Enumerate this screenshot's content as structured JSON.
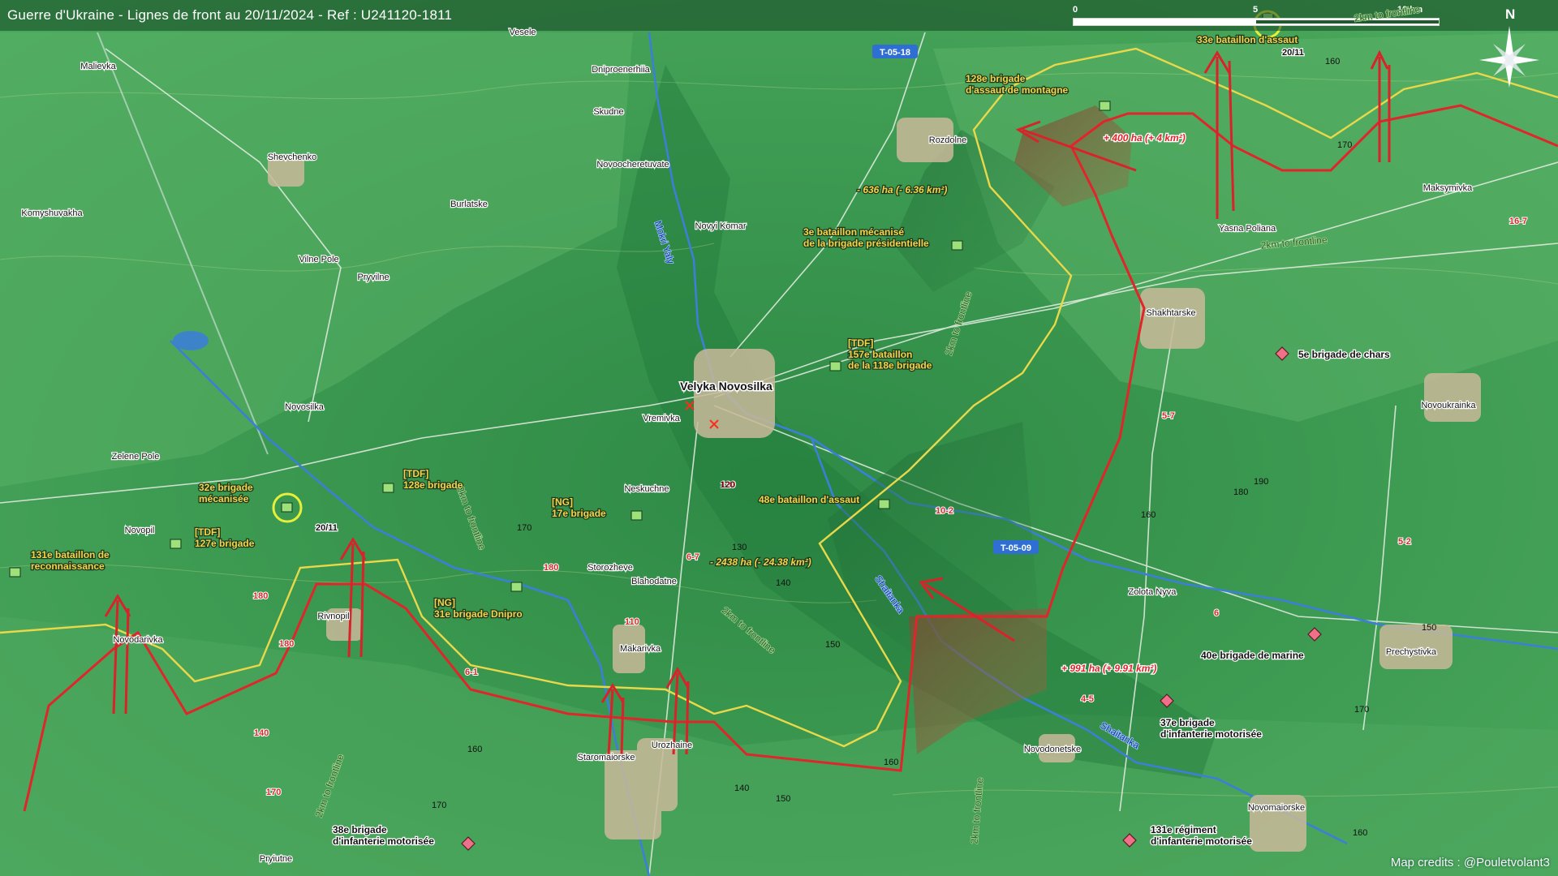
{
  "title": "Guerre d'Ukraine - Lignes de front au 20/11/2024 - Ref : U241120-1811",
  "credits": "Map credits : @Pouletvolant3",
  "scale": {
    "zero": "0",
    "mid": "5",
    "end": "10 km"
  },
  "compass": "N",
  "colors": {
    "background": "#3f9a55",
    "ukraine_line": "#e9d84a",
    "russia_line": "#e0252b",
    "river": "#3c7fd6",
    "gain_area": "#8a5a3a",
    "label": "#f7d34a"
  },
  "places": [
    {
      "name": "Malievka"
    },
    {
      "name": "Veselе"
    },
    {
      "name": "Dniproenerhiia"
    },
    {
      "name": "Skudne"
    },
    {
      "name": "Shevchenko"
    },
    {
      "name": "Novoocheretuvate"
    },
    {
      "name": "Burlatske"
    },
    {
      "name": "Komyshuvakha"
    },
    {
      "name": "Novyi Komar"
    },
    {
      "name": "Vilne Pole"
    },
    {
      "name": "Pryvilne"
    },
    {
      "name": "Rozdolne"
    },
    {
      "name": "Yasna Poliana"
    },
    {
      "name": "Maksymivka"
    },
    {
      "name": "Shakhtarske"
    },
    {
      "name": "Velyka Novosilka"
    },
    {
      "name": "Vremivka"
    },
    {
      "name": "Novosilka"
    },
    {
      "name": "Zelene Pole"
    },
    {
      "name": "Neskuchne"
    },
    {
      "name": "Novopil"
    },
    {
      "name": "Storozheve"
    },
    {
      "name": "Blahodatne"
    },
    {
      "name": "Novoukrainka"
    },
    {
      "name": "Rivnopil"
    },
    {
      "name": "Novodarivka"
    },
    {
      "name": "Makarivka"
    },
    {
      "name": "Zolota Nyva"
    },
    {
      "name": "Prechystivka"
    },
    {
      "name": "Staromaiorske"
    },
    {
      "name": "Urozhaine"
    },
    {
      "name": "Novodonetske"
    },
    {
      "name": "Novomaiorske"
    },
    {
      "name": "Pryiutne"
    }
  ],
  "units": [
    {
      "text": "33e bataillon d'assaut"
    },
    {
      "text": "128e brigade\nd'assaut de montagne"
    },
    {
      "text": "3e bataillon mécanisé\nde la brigade présidentielle"
    },
    {
      "text": "[TDF]\n157e bataillon\nde la 118e brigade"
    },
    {
      "text": "[TDF]\n128e brigade"
    },
    {
      "text": "32e brigade\nmécanisée"
    },
    {
      "text": "[TDF]\n127e brigade"
    },
    {
      "text": "131e bataillon de\nreconnaissance"
    },
    {
      "text": "[NG]\n17e brigade"
    },
    {
      "text": "48e bataillon d'assaut"
    },
    {
      "text": "[NG]\n31e brigade Dnipro"
    },
    {
      "text": "5e brigade de chars"
    },
    {
      "text": "40e brigade de marine"
    },
    {
      "text": "37e brigade\nd'infanterie motorisée"
    },
    {
      "text": "38e brigade\nd'infanterie motorisée"
    },
    {
      "text": "131e régiment\nd'infanterie motorisée"
    }
  ],
  "annotations": [
    {
      "text": "+ 400 ha (+ 4 km²)"
    },
    {
      "text": "- 636 ha (- 6.36 km²)"
    },
    {
      "text": "- 2438 ha (- 24.38 km²)"
    },
    {
      "text": "+ 991 ha (+ 9.91 km²)"
    }
  ],
  "dates": [
    "20/11",
    "20/11"
  ],
  "road_badges": [
    "T-05-18",
    "T-05-09"
  ],
  "road_numbers": [
    "110",
    "140",
    "180",
    "180",
    "180",
    "170",
    "120",
    "6-1",
    "6-7",
    "5-7",
    "5-2",
    "16-7",
    "10-2",
    "4-5",
    "6"
  ],
  "frontline_labels": [
    "2km to frontline",
    "2km to frontline",
    "2km to frontline",
    "2km to frontline",
    "2km to frontline",
    "2km to frontline",
    "2km to frontline"
  ],
  "rivers": [
    "Mokri Yaly",
    "Shaitanka",
    "Shaitanka"
  ],
  "elevations": [
    "160",
    "170",
    "190",
    "180",
    "160",
    "150",
    "170",
    "130",
    "140",
    "150",
    "160",
    "120",
    "170",
    "170",
    "160",
    "140",
    "150",
    "160"
  ]
}
